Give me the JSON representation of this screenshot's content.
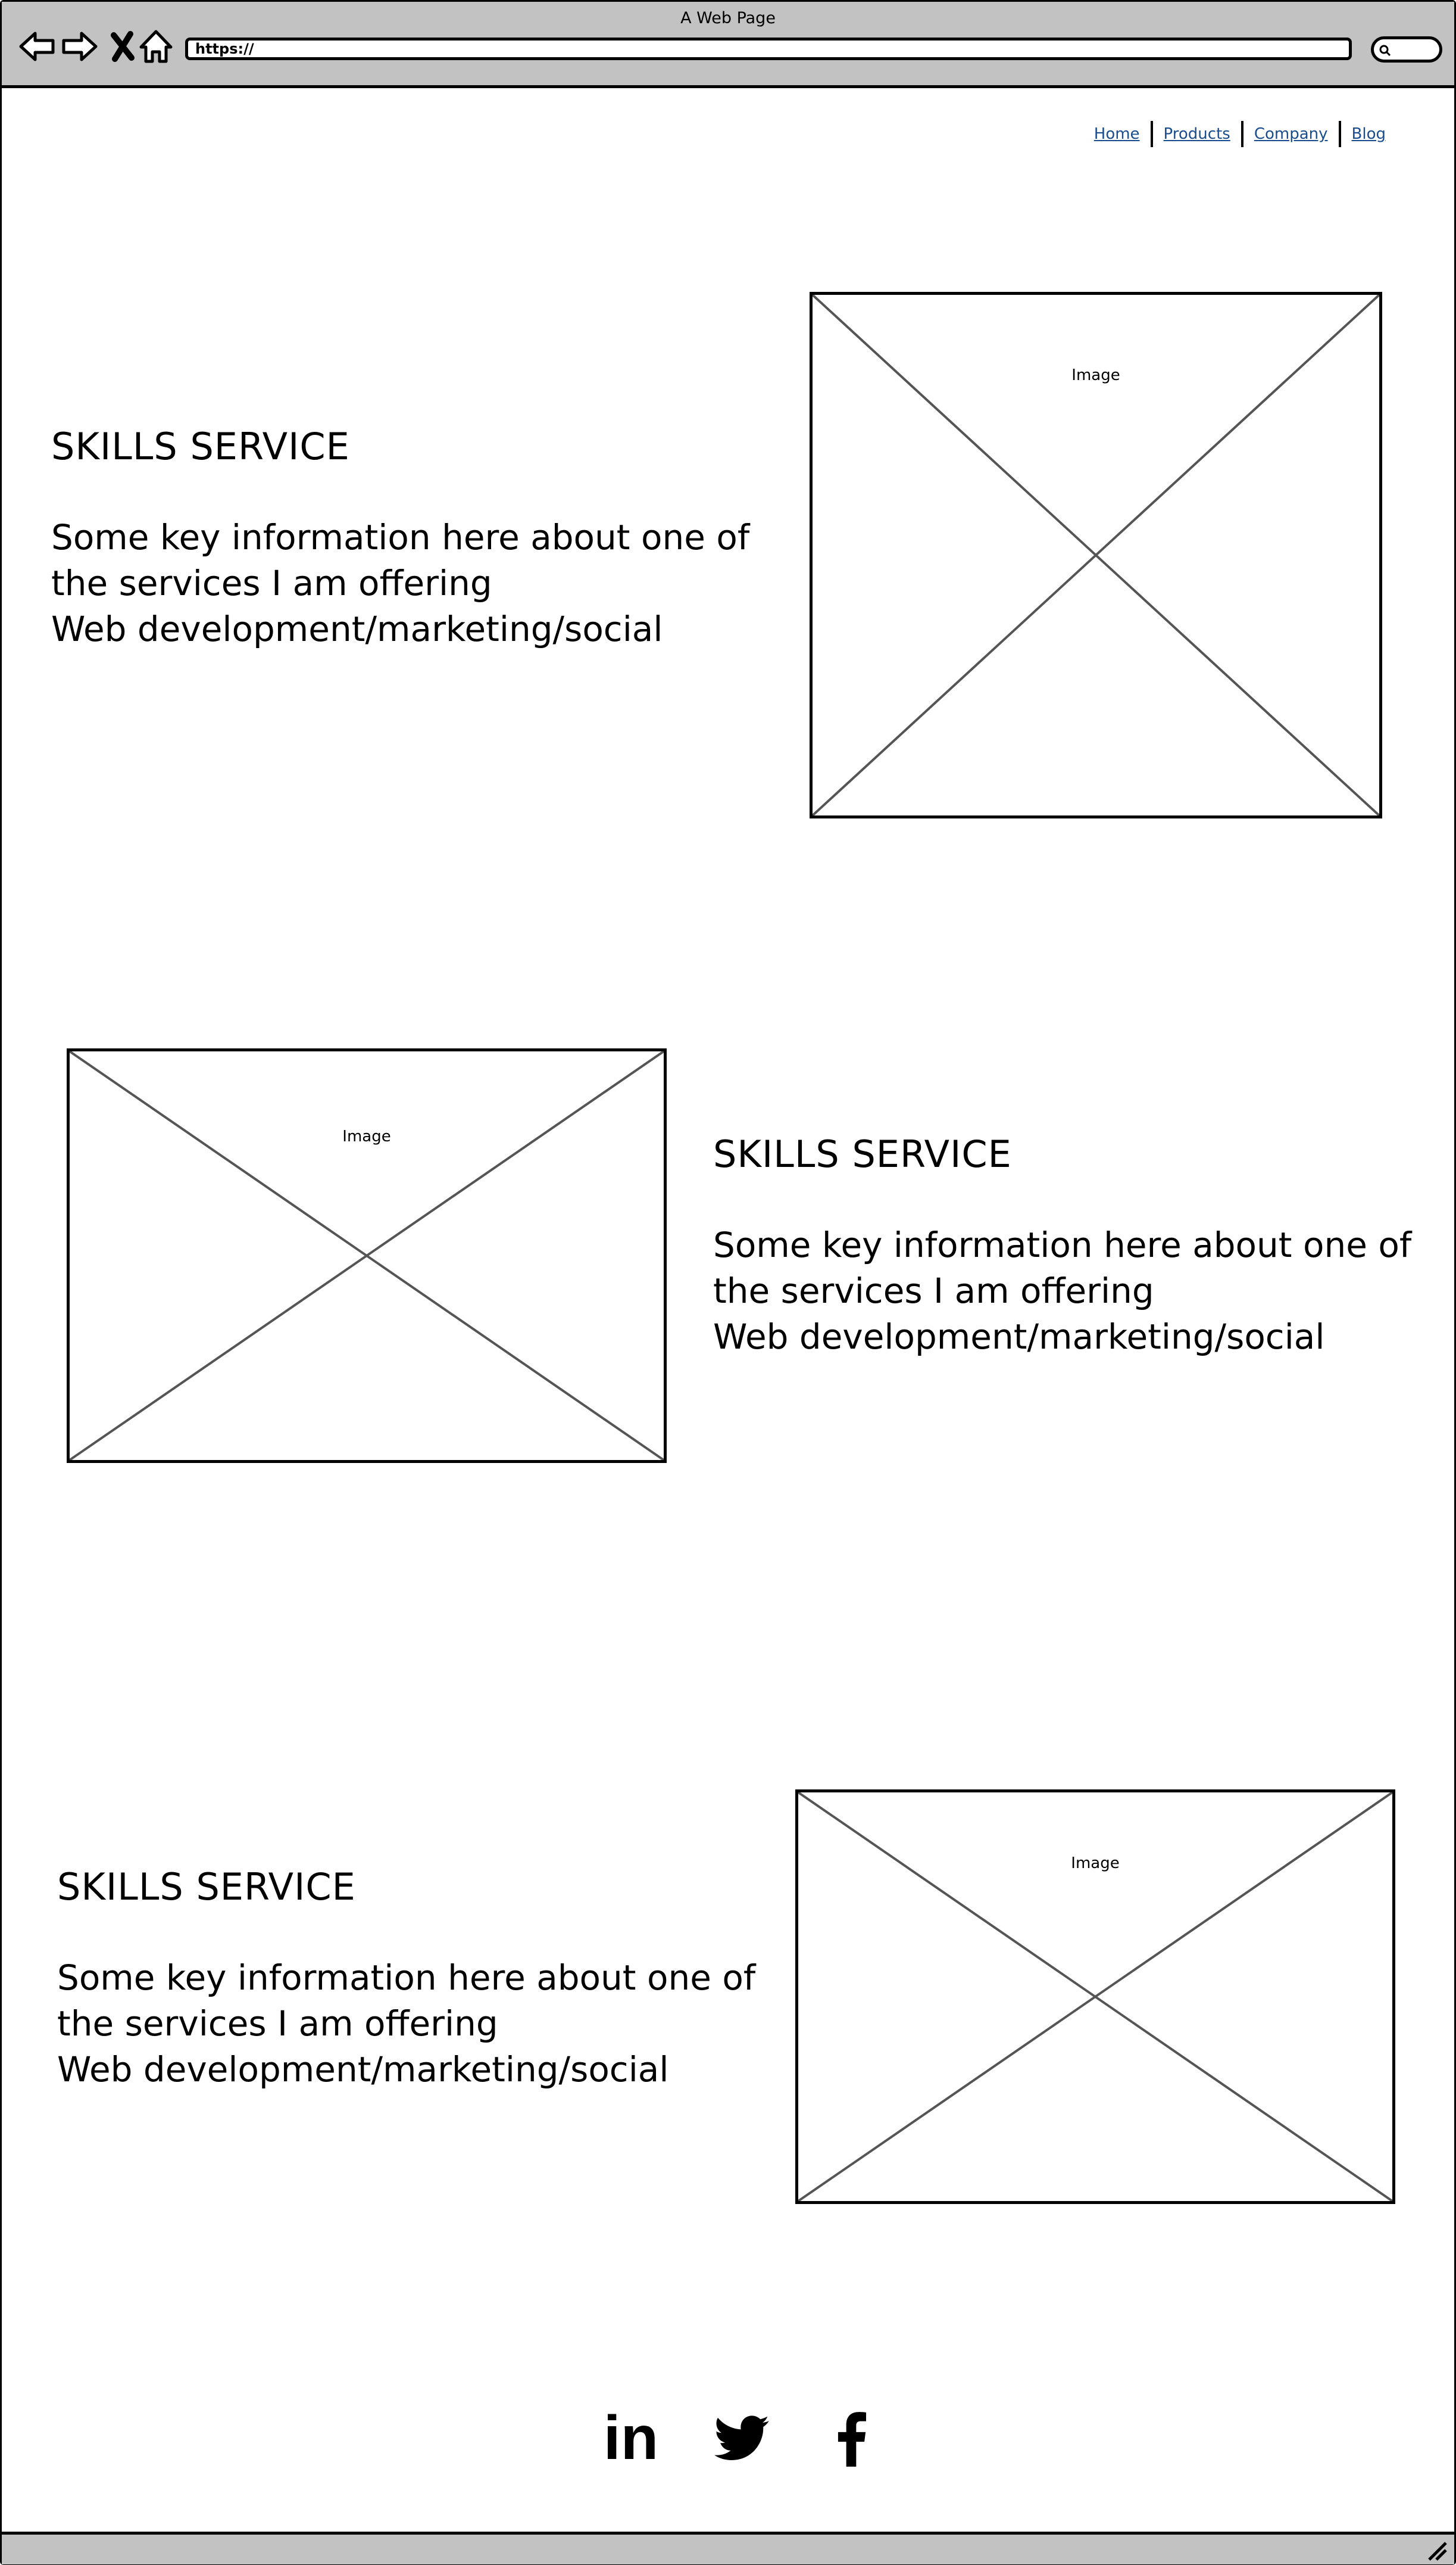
{
  "window": {
    "title": "A Web Page"
  },
  "address_bar": {
    "url": "https://"
  },
  "nav": {
    "items": [
      {
        "label": "Home"
      },
      {
        "label": "Products"
      },
      {
        "label": "Company"
      },
      {
        "label": "Blog"
      }
    ]
  },
  "sections": [
    {
      "title": "SKILLS SERVICE",
      "line1": "Some key information here about one of",
      "line2": "the services I am offering",
      "line3": "Web development/marketing/social",
      "image_label": "Image"
    },
    {
      "title": "SKILLS SERVICE",
      "line1": "Some key information here about one of",
      "line2": "the services I am offering",
      "line3": "Web development/marketing/social",
      "image_label": "Image"
    },
    {
      "title": "SKILLS SERVICE",
      "line1": "Some key information here about one of",
      "line2": "the services I am offering",
      "line3": "Web development/marketing/social",
      "image_label": "Image"
    }
  ],
  "social": {
    "icons": [
      "linkedin-icon",
      "twitter-icon",
      "facebook-icon"
    ],
    "linkedin_text": "in"
  },
  "colors": {
    "chrome": "#c2c2c2",
    "link": "#1a4d8f",
    "placeholder_line": "#555555"
  }
}
